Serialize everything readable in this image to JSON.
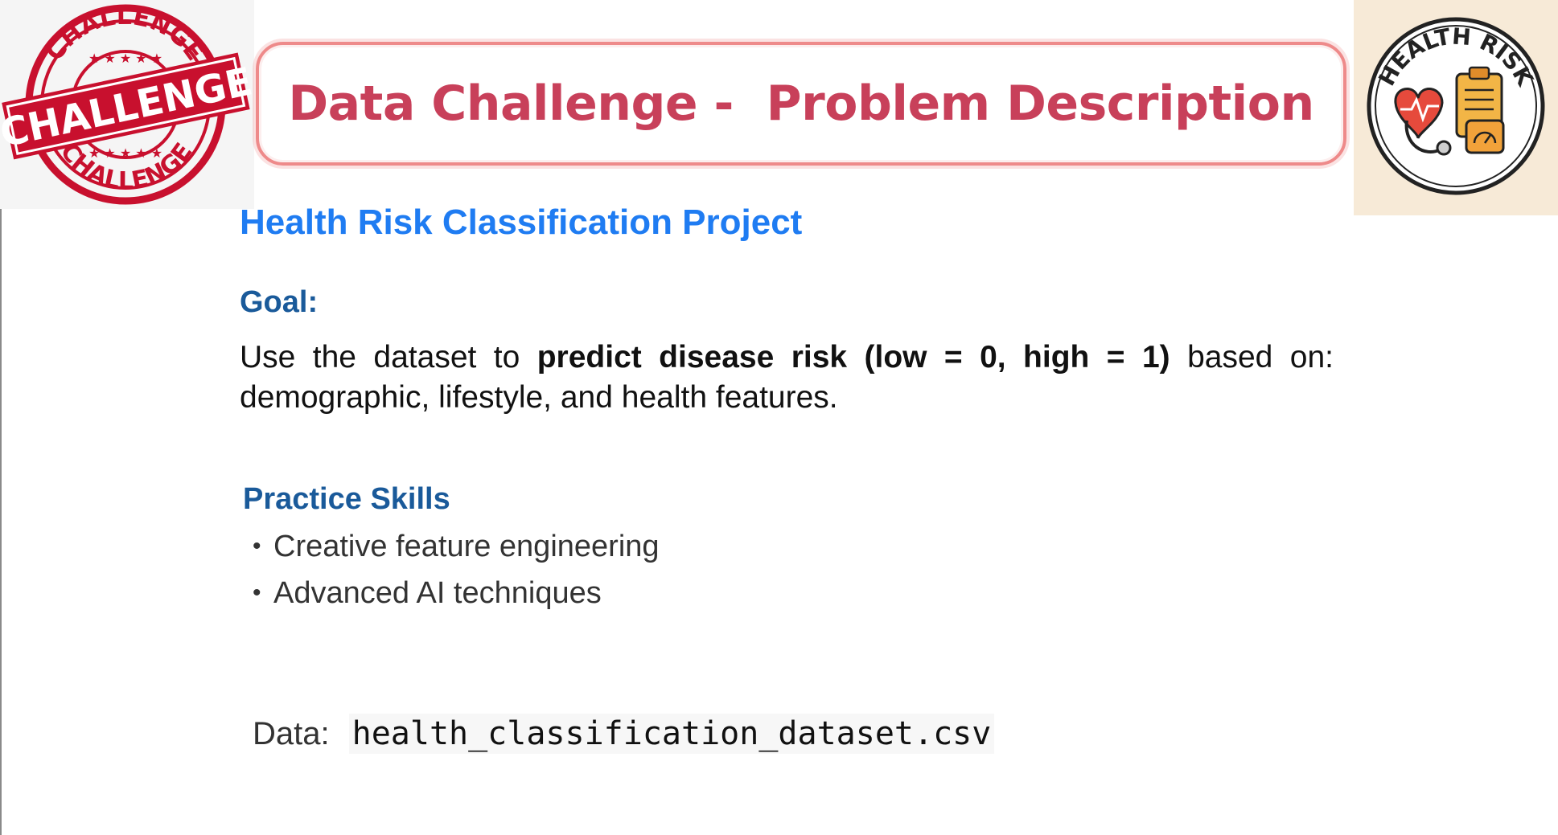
{
  "header": {
    "title": "Data Challenge -  Problem Description",
    "stamp_logo_text": "CHALLENGE",
    "badge_logo_text": "HEALTH RISK"
  },
  "main": {
    "project_title": "Health Risk Classification Project",
    "goal": {
      "heading": "Goal:",
      "text_prefix": "Use the dataset to ",
      "text_bold": "predict disease risk (low = 0, high = 1)",
      "text_suffix": " based on:",
      "text_line2": "demographic, lifestyle, and health features."
    },
    "skills": {
      "heading": "Practice Skills",
      "bullet": "•",
      "items": [
        {
          "label": "Creative feature engineering"
        },
        {
          "label": "Advanced AI techniques"
        }
      ]
    },
    "data": {
      "label": "Data:",
      "filename": "health_classification_dataset.csv"
    }
  },
  "colors": {
    "title": "#c8405a",
    "title_frame": "#ee8a8a",
    "project_title": "#1f7cf2",
    "heading": "#1a5a9a",
    "stamp_red": "#c8102e",
    "badge_bg": "#f7ead7"
  }
}
